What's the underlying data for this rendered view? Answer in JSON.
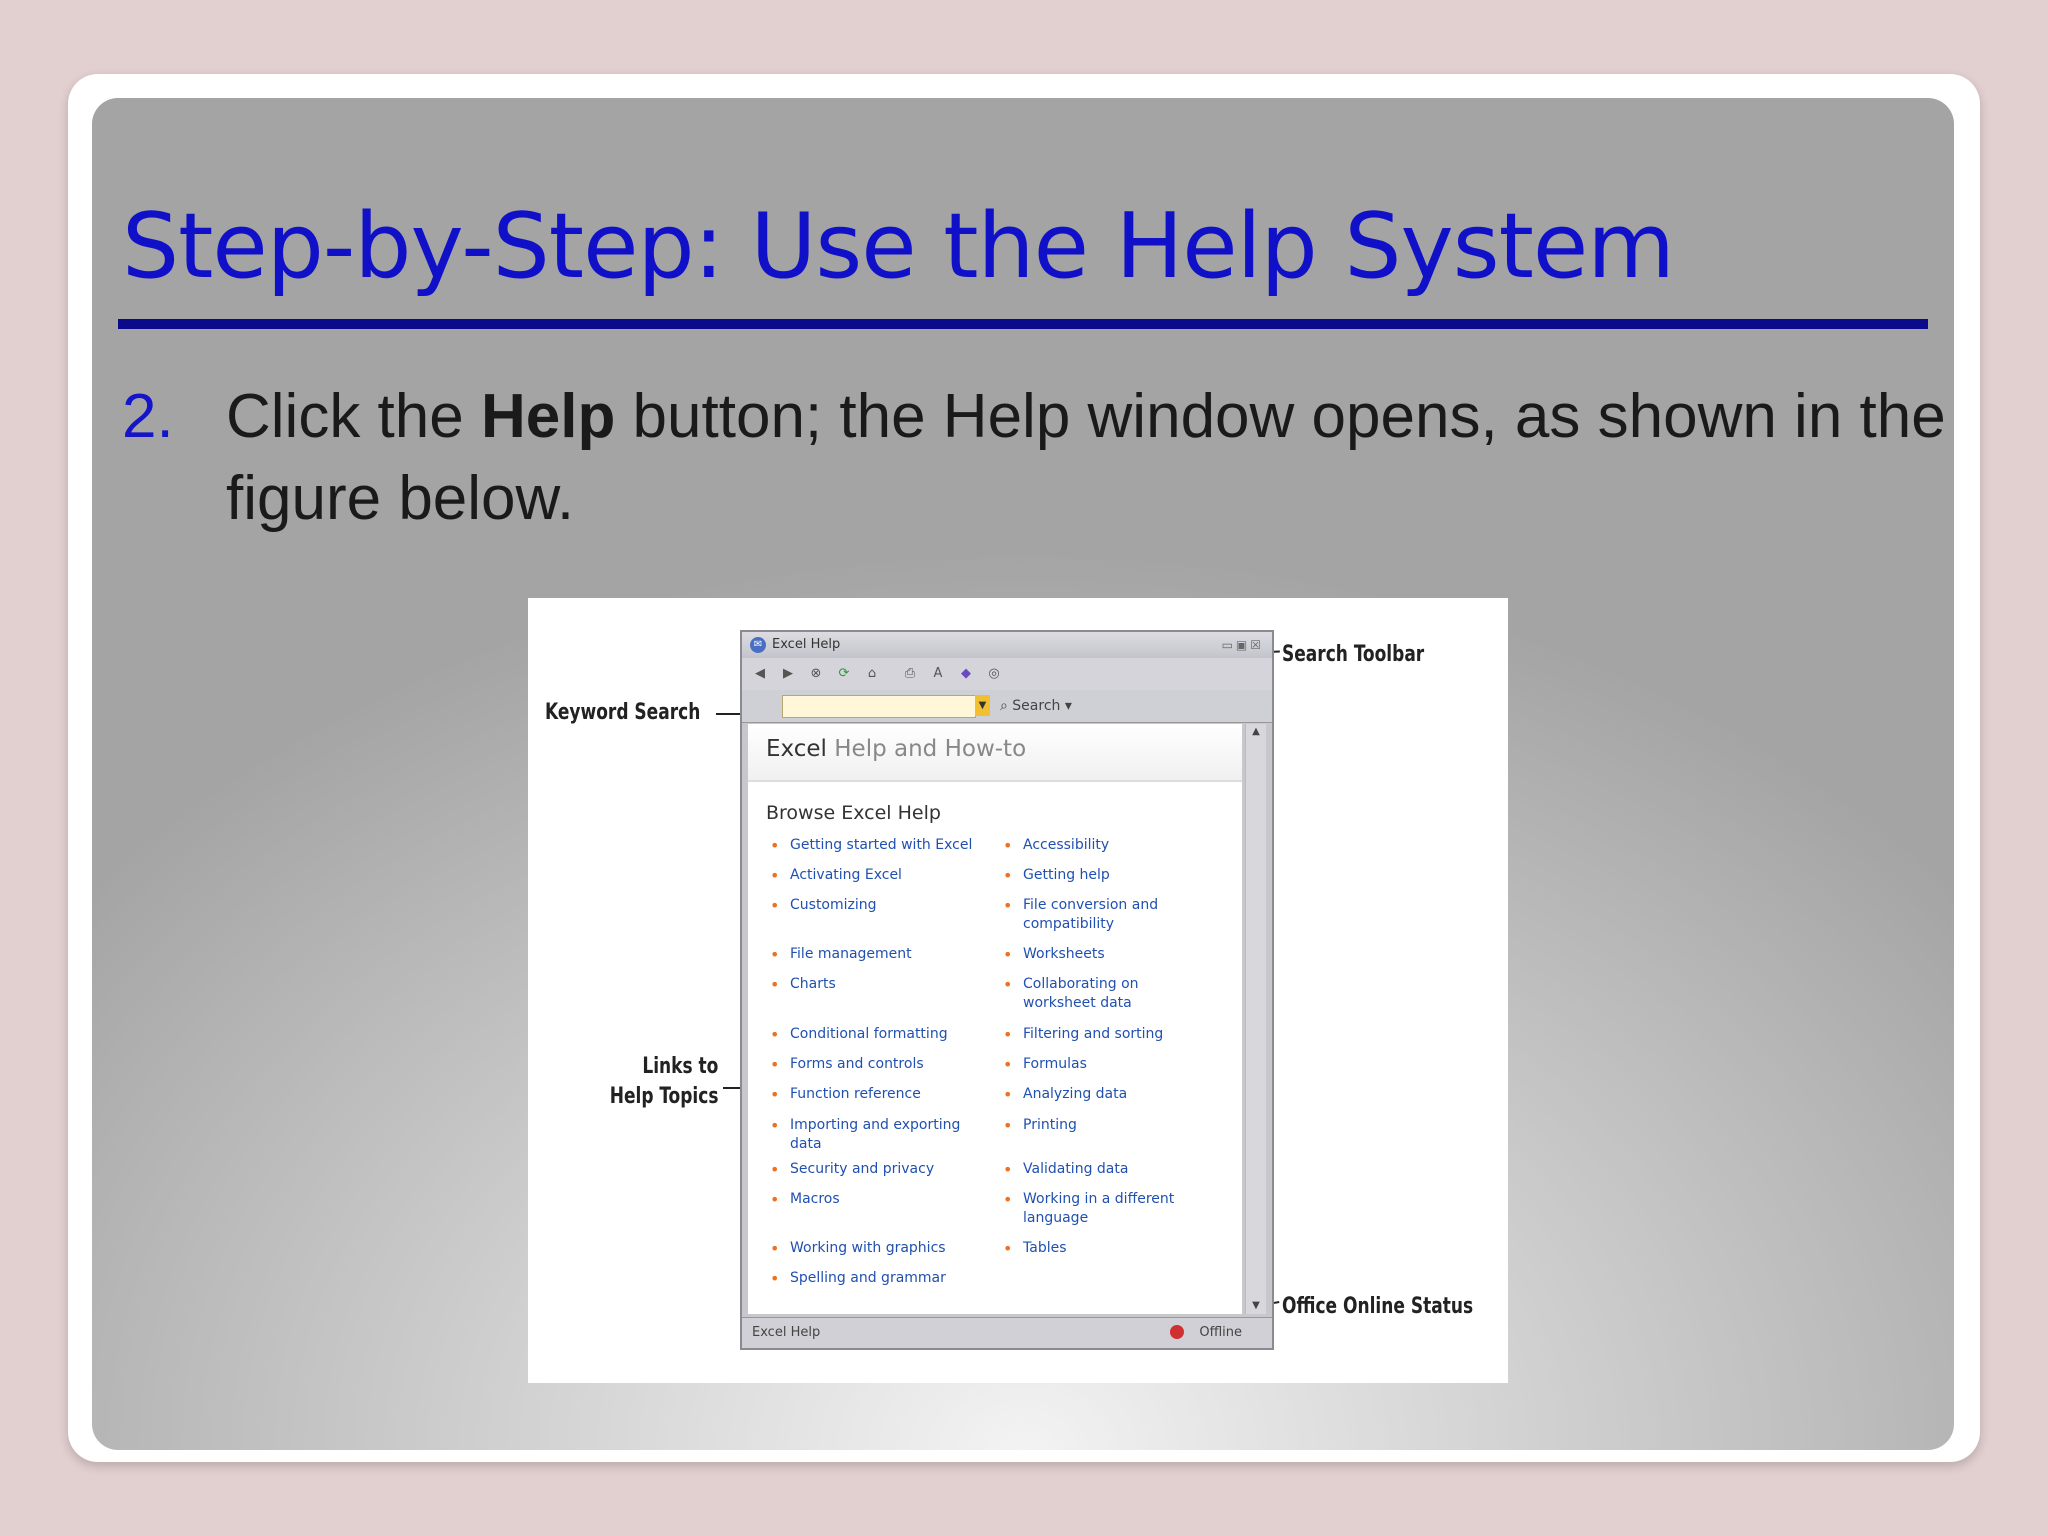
{
  "slide": {
    "title": "Step-by-Step: Use the Help System",
    "step_number": "2.",
    "step_text_before": "Click the ",
    "step_text_bold": "Help",
    "step_text_after": " button; the Help window opens, as shown in the figure below."
  },
  "figure": {
    "callouts": {
      "search_toolbar": "Search Toolbar",
      "keyword_search": "Keyword Search",
      "links_line1": "Links to",
      "links_line2": "Help Topics",
      "office_online_status": "Office Online Status"
    },
    "window": {
      "title": "Excel Help",
      "search_button": "Search",
      "header_excel": "Excel",
      "header_rest": " Help and How-to",
      "browse_heading": "Browse Excel Help",
      "links_left": [
        "Getting started with Excel",
        "Activating Excel",
        "Customizing",
        "File management",
        "Charts",
        "Conditional formatting",
        "Forms and controls",
        "Function reference",
        "Importing and exporting data",
        "Security and privacy",
        "Macros",
        "Working with graphics",
        "Spelling and grammar"
      ],
      "links_right": [
        "Accessibility",
        "Getting help",
        "File conversion and compatibility",
        "Worksheets",
        "Collaborating on worksheet data",
        "Filtering and sorting",
        "Formulas",
        "Analyzing data",
        "Printing",
        "Validating data",
        "Working in a different language",
        "Tables"
      ],
      "status_left": "Excel Help",
      "status_right": "Offline"
    }
  }
}
